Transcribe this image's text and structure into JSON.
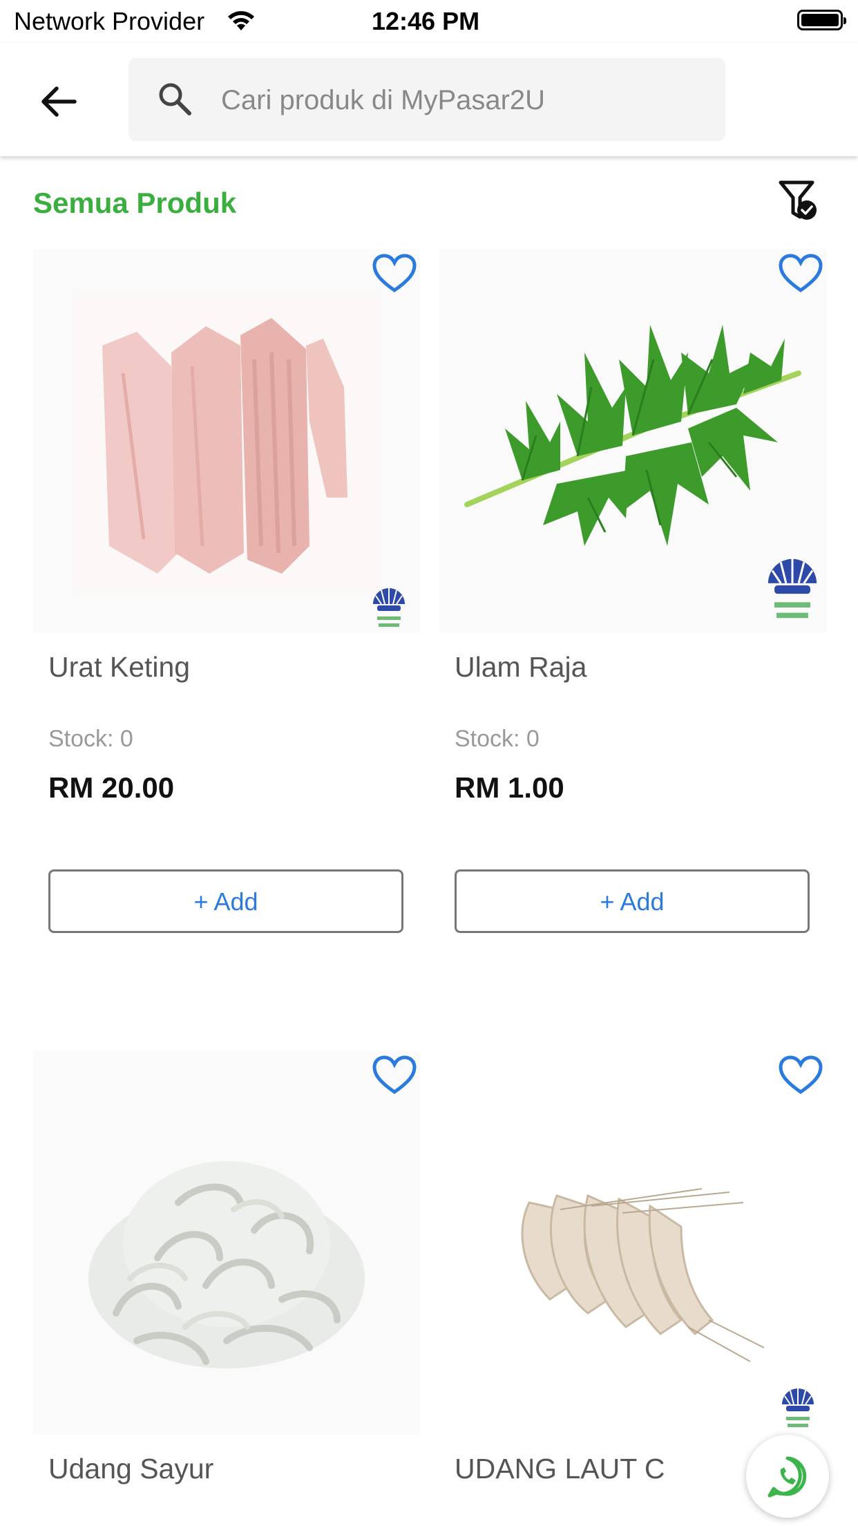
{
  "status": {
    "carrier": "Network Provider",
    "time": "12:46 PM"
  },
  "search": {
    "placeholder": "Cari produk di MyPasar2U",
    "icon": "search-icon"
  },
  "section": {
    "title": "Semua Produk"
  },
  "colors": {
    "accent": "#3aae3e",
    "link": "#2b7bde",
    "heart": "#2b7bde"
  },
  "products": [
    {
      "name": "Urat Keting",
      "stock": "Stock: 0",
      "price": "RM 20.00",
      "add_label": "+ Add",
      "favorite": false
    },
    {
      "name": "Ulam Raja",
      "stock": "Stock: 0",
      "price": "RM 1.00",
      "add_label": "+ Add",
      "favorite": false
    },
    {
      "name": "Udang Sayur",
      "favorite": false
    },
    {
      "name": "UDANG LAUT C",
      "favorite": false
    }
  ],
  "brand_logo": "Mutiara Bersatu",
  "fab": {
    "icon": "whatsapp-icon"
  }
}
